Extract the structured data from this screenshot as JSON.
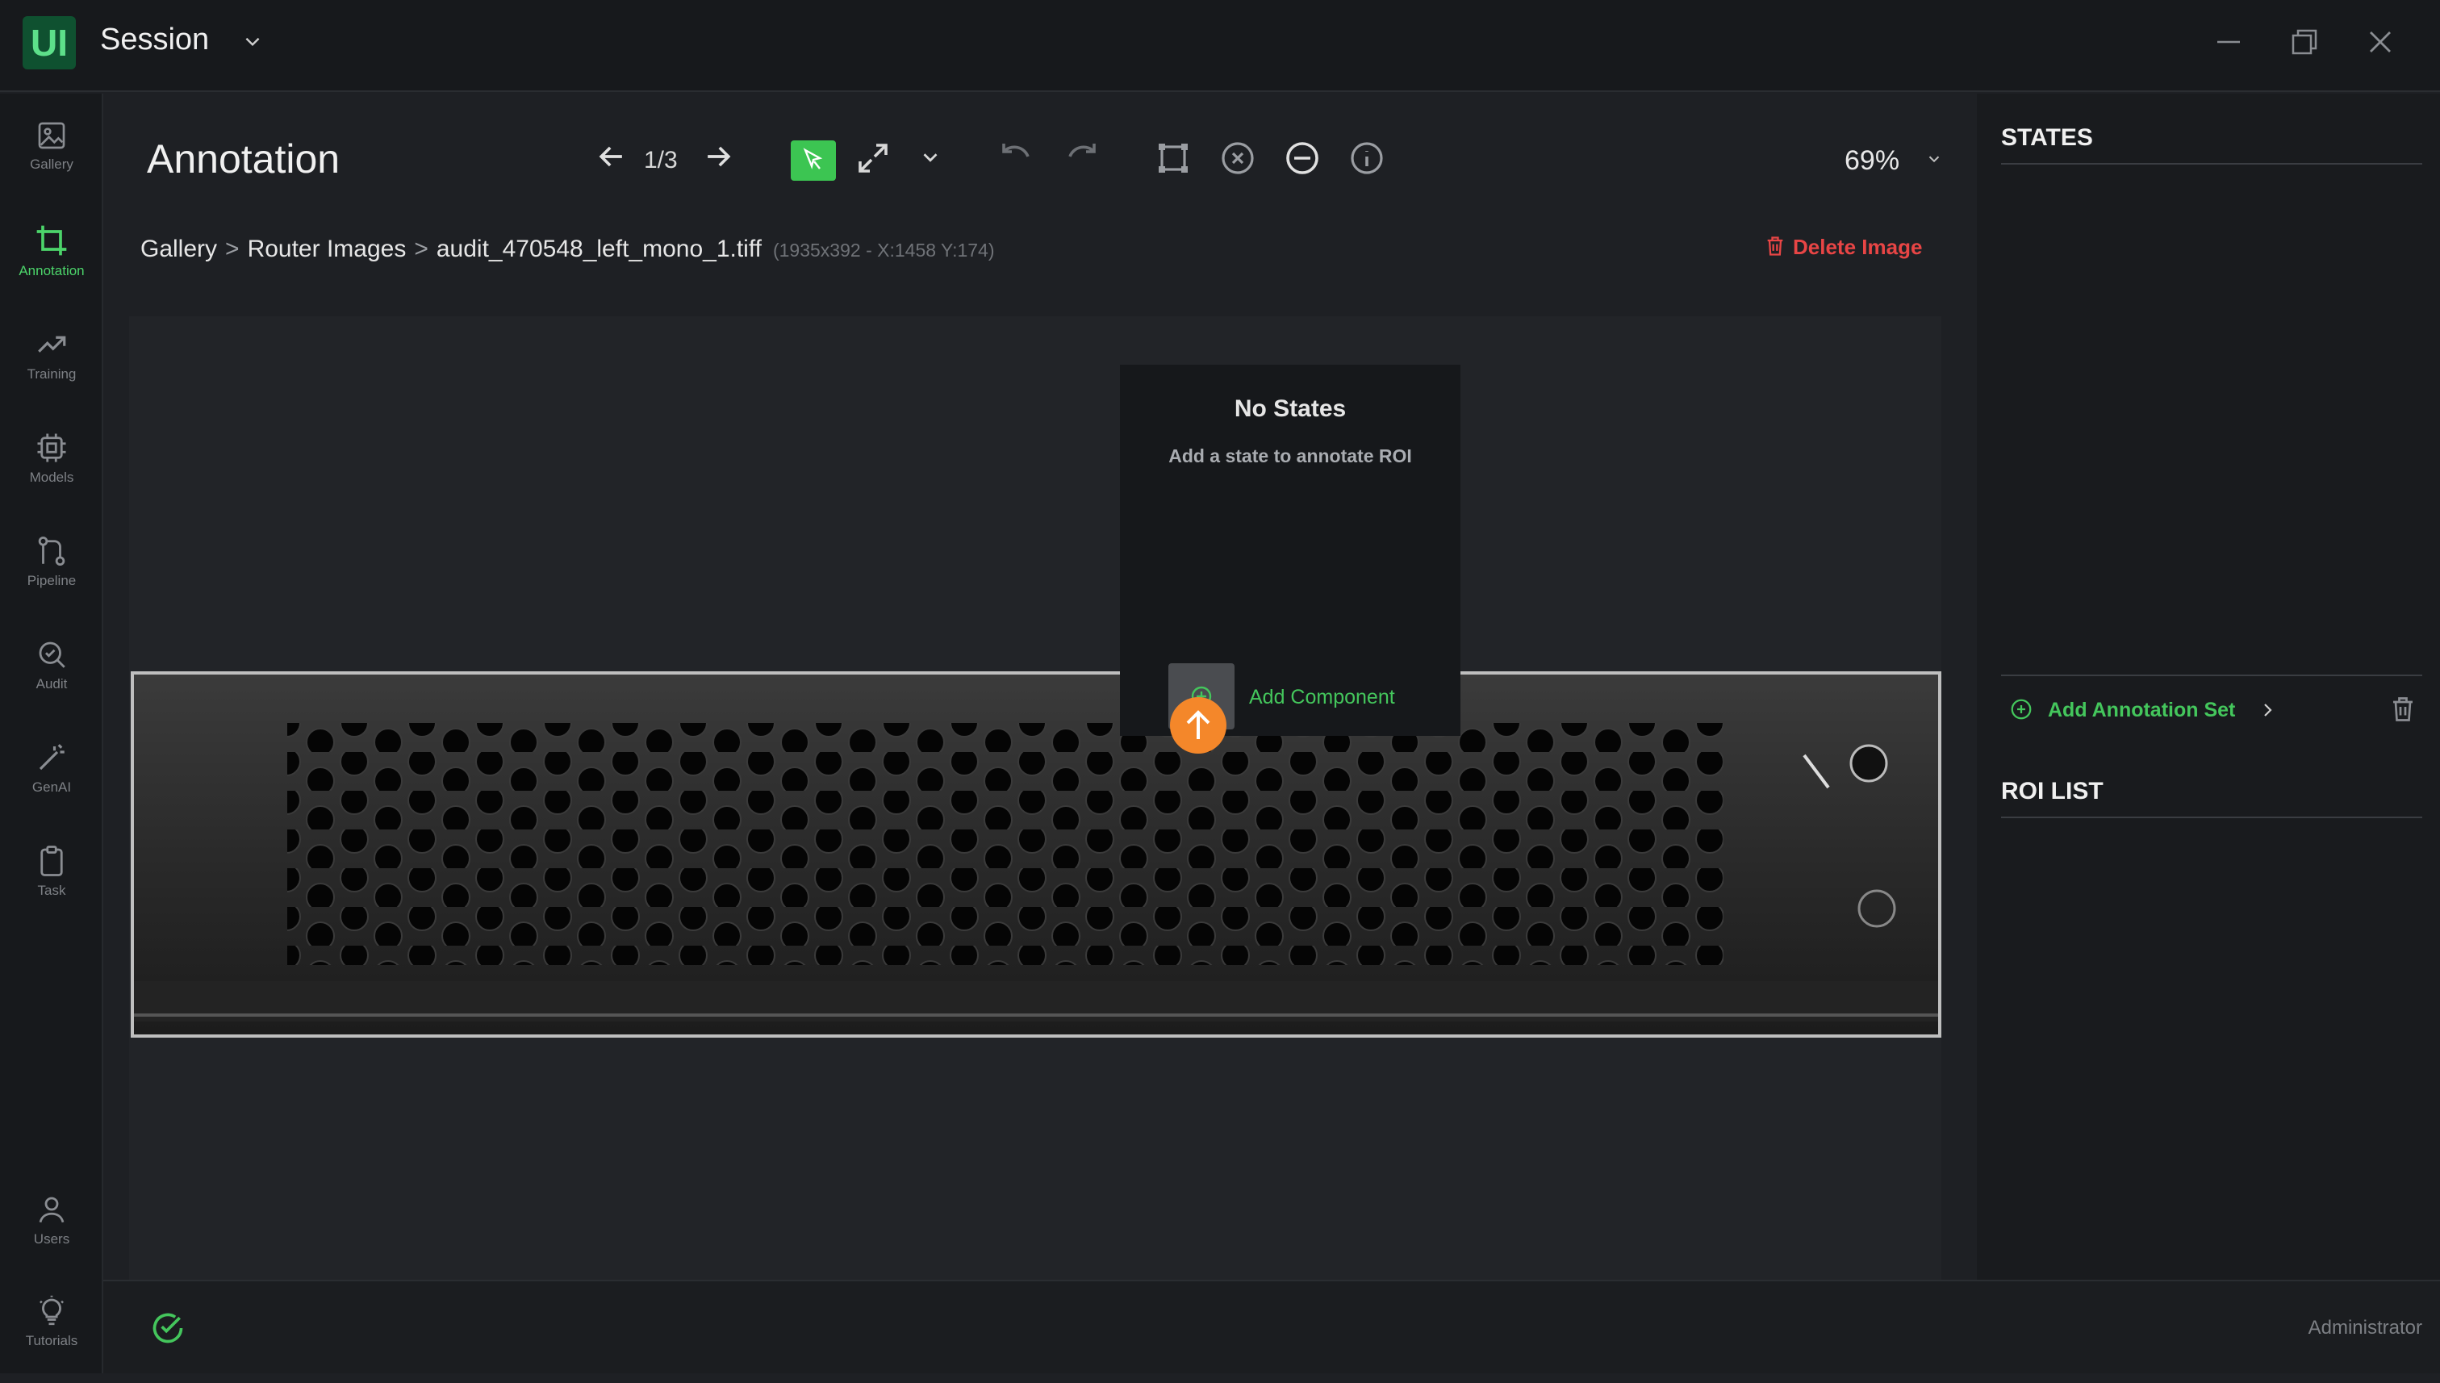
{
  "app": {
    "logo_text": "UI",
    "title": "Session"
  },
  "rail": {
    "items": [
      {
        "label": "Gallery"
      },
      {
        "label": "Annotation"
      },
      {
        "label": "Training"
      },
      {
        "label": "Models"
      },
      {
        "label": "Pipeline"
      },
      {
        "label": "Audit"
      },
      {
        "label": "GenAI"
      },
      {
        "label": "Task"
      },
      {
        "label": "Users"
      },
      {
        "label": "Tutorials"
      }
    ],
    "active": "Annotation"
  },
  "toolbar": {
    "title": "Annotation",
    "page_counter": "1/3",
    "zoom": "69%"
  },
  "breadcrumb": {
    "items": [
      "Gallery",
      "Router Images",
      "audit_470548_left_mono_1.tiff"
    ],
    "separator": ">",
    "meta": "(1935x392 - X:1458 Y:174)"
  },
  "actions": {
    "delete_image": "Delete Image"
  },
  "overlay": {
    "title": "No States",
    "subtitle": "Add a state to annotate ROI",
    "add_component": "Add Component"
  },
  "right_panel": {
    "states_title": "STATES",
    "add_annotation_set": "Add Annotation Set",
    "roi_title": "ROI LIST"
  },
  "footer": {
    "user": "Administrator"
  },
  "colors": {
    "accent": "#3cc552",
    "danger": "#e84545",
    "upload": "#f4872a"
  }
}
